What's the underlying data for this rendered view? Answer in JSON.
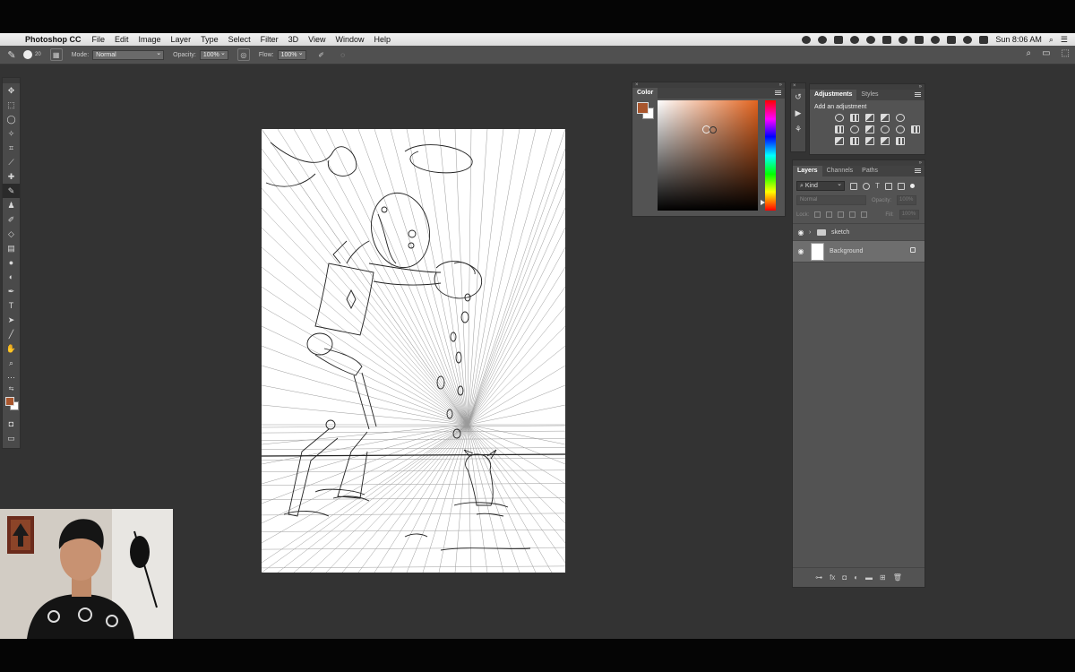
{
  "menubar": {
    "app_name": "Photoshop CC",
    "items": [
      "File",
      "Edit",
      "Image",
      "Layer",
      "Type",
      "Select",
      "Filter",
      "3D",
      "View",
      "Window",
      "Help"
    ],
    "clock": "Sun 8:06 AM"
  },
  "options_bar": {
    "brush_size": "20",
    "mode_label": "Mode:",
    "mode_value": "Normal",
    "opacity_label": "Opacity:",
    "opacity_value": "100%",
    "flow_label": "Flow:",
    "flow_value": "100%"
  },
  "tools": [
    "move-tool",
    "marquee-tool",
    "lasso-tool",
    "magic-wand-tool",
    "crop-tool",
    "eyedropper-tool",
    "healing-brush-tool",
    "brush-tool",
    "clone-stamp-tool",
    "history-brush-tool",
    "eraser-tool",
    "gradient-tool",
    "blur-tool",
    "dodge-tool",
    "pen-tool",
    "type-tool",
    "path-selection-tool",
    "line-tool",
    "hand-tool",
    "zoom-tool",
    "more-tools"
  ],
  "colors": {
    "foreground": "#a9562d",
    "background": "#ffffff",
    "workspace": "#333333"
  },
  "color_panel": {
    "tab": "Color"
  },
  "adjustments_panel": {
    "tabs": [
      "Adjustments",
      "Styles"
    ],
    "heading": "Add an adjustment"
  },
  "layers_panel": {
    "tabs": [
      "Layers",
      "Channels",
      "Paths"
    ],
    "filter_kind": "Kind",
    "blend_mode": "Normal",
    "opacity_label": "Opacity:",
    "opacity_value": "100%",
    "lock_label": "Lock:",
    "fill_label": "Fill:",
    "fill_value": "100%",
    "layers": [
      {
        "name": "sketch",
        "type": "group"
      },
      {
        "name": "Background",
        "type": "pixel"
      }
    ]
  }
}
